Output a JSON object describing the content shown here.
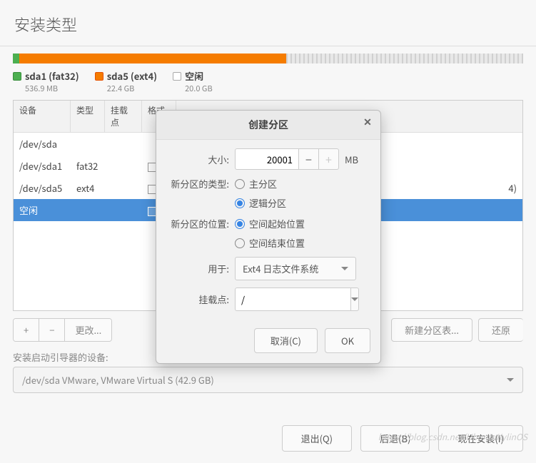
{
  "window": {
    "title": "安装类型"
  },
  "diskbar": {
    "segments": [
      {
        "color": "seg-green",
        "pct": 1.3
      },
      {
        "color": "seg-orange",
        "pct": 52.2
      },
      {
        "color": "seg-grey",
        "pct": 46.5
      }
    ]
  },
  "legend": [
    {
      "swatch": "sq-green",
      "name": "sda1 (fat32)",
      "sub": "536.9 MB"
    },
    {
      "swatch": "sq-orange",
      "name": "sda5 (ext4)",
      "sub": "22.4 GB"
    },
    {
      "swatch": "sq-white",
      "name": "空闲",
      "sub": "20.0 GB"
    }
  ],
  "table": {
    "headers": {
      "device": "设备",
      "type": "类型",
      "mountpoint": "挂载点",
      "format": "格式"
    },
    "rows": [
      {
        "device": "/dev/sda",
        "type": "",
        "mountpoint": "",
        "format_chk": false,
        "extra": "",
        "selected": false
      },
      {
        "device": " /dev/sda1",
        "type": "fat32",
        "mountpoint": "",
        "format_chk": true,
        "extra": "",
        "selected": false
      },
      {
        "device": " /dev/sda5",
        "type": "ext4",
        "mountpoint": "",
        "format_chk": true,
        "extra": "4)",
        "selected": false
      },
      {
        "device": " 空闲",
        "type": "",
        "mountpoint": "",
        "format_chk": true,
        "extra": "",
        "selected": true
      }
    ]
  },
  "toolbar": {
    "add": "+",
    "remove": "−",
    "change": "更改...",
    "new_table": "新建分区表...",
    "revert": "还原"
  },
  "bootloader": {
    "label": "安装启动引导器的设备:",
    "value": "/dev/sda   VMware, VMware Virtual S (42.9 GB)"
  },
  "footer": {
    "quit": "退出(Q)",
    "back": "后退(B)",
    "install": "现在安装(I)"
  },
  "dialog": {
    "title": "创建分区",
    "size_label": "大小:",
    "size_value": "20001",
    "size_unit": "MB",
    "type_label": "新分区的类型:",
    "type_options": {
      "primary": "主分区",
      "logical": "逻辑分区"
    },
    "type_selected": "logical",
    "pos_label": "新分区的位置:",
    "pos_options": {
      "begin": "空间起始位置",
      "end": "空间结束位置"
    },
    "pos_selected": "begin",
    "use_label": "用于:",
    "use_value": "Ext4 日志文件系统",
    "mount_label": "挂载点:",
    "mount_value": "/",
    "cancel": "取消(C)",
    "ok": "OK"
  },
  "watermark": "https://blog.csdn.net/UbuntuKylinOS"
}
